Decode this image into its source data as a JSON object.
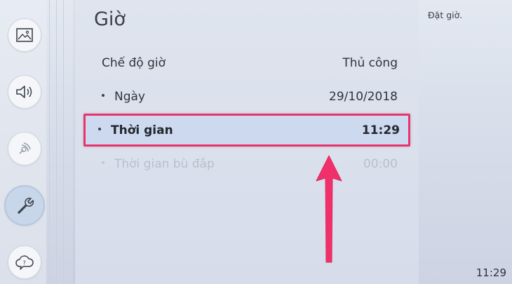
{
  "sidebar": {
    "items": [
      {
        "icon": "picture-icon",
        "label": ""
      },
      {
        "icon": "speaker-icon",
        "label": ""
      },
      {
        "icon": "broadcast-icon",
        "label": ""
      },
      {
        "icon": "wrench-icon",
        "label": "",
        "active": true
      },
      {
        "icon": "help-cloud-icon",
        "label": ""
      }
    ]
  },
  "panel": {
    "title": "Giờ",
    "rows": [
      {
        "label": "Chế độ giờ",
        "value": "Thủ công"
      },
      {
        "label": "Ngày",
        "value": "29/10/2018"
      },
      {
        "label": "Thời gian",
        "value": "11:29",
        "selected": true
      },
      {
        "label": "Thời gian bù đắp",
        "value": "00:00",
        "disabled": true
      }
    ]
  },
  "info": {
    "description": "Đặt giờ."
  },
  "status": {
    "clock": "11:29"
  },
  "colors": {
    "highlight_border": "#e8336c",
    "arrow": "#f0306a"
  }
}
